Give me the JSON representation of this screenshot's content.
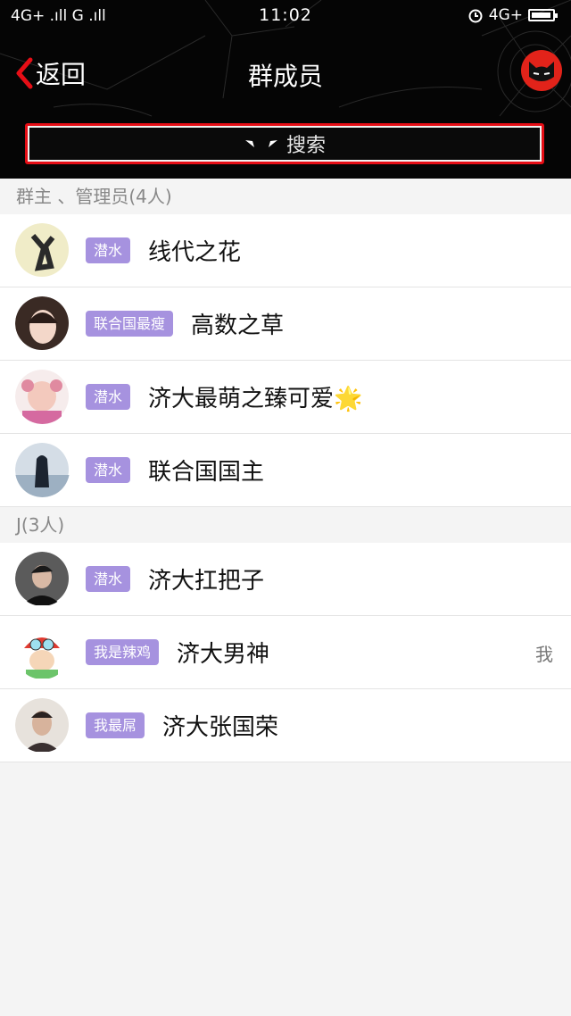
{
  "status_bar": {
    "network_left": "4G+ .ıll G .ıll",
    "time": "11:02",
    "network_right": "4G+",
    "battery_percent": 95
  },
  "nav": {
    "back_label": "返回",
    "title": "群成员"
  },
  "search": {
    "placeholder": "搜索"
  },
  "sections": [
    {
      "header": "群主 、管理员(4人)",
      "members": [
        {
          "badge": "潜水",
          "name": "线代之花"
        },
        {
          "badge": "联合国最瘦",
          "name": "高数之草"
        },
        {
          "badge": "潜水",
          "name": "济大最萌之臻可爱🌟"
        },
        {
          "badge": "潜水",
          "name": "联合国国主"
        }
      ]
    },
    {
      "header": "J(3人)",
      "members": [
        {
          "badge": "潜水",
          "name": "济大扛把子"
        },
        {
          "badge": "我是辣鸡",
          "name": "济大男神",
          "me": "我"
        },
        {
          "badge": "我最屌",
          "name": "济大张国荣"
        }
      ]
    }
  ],
  "colors": {
    "header_bg": "#050505",
    "search_border": "#e60e16",
    "badge": "#a692df",
    "cat_icon": "#e2231a"
  }
}
